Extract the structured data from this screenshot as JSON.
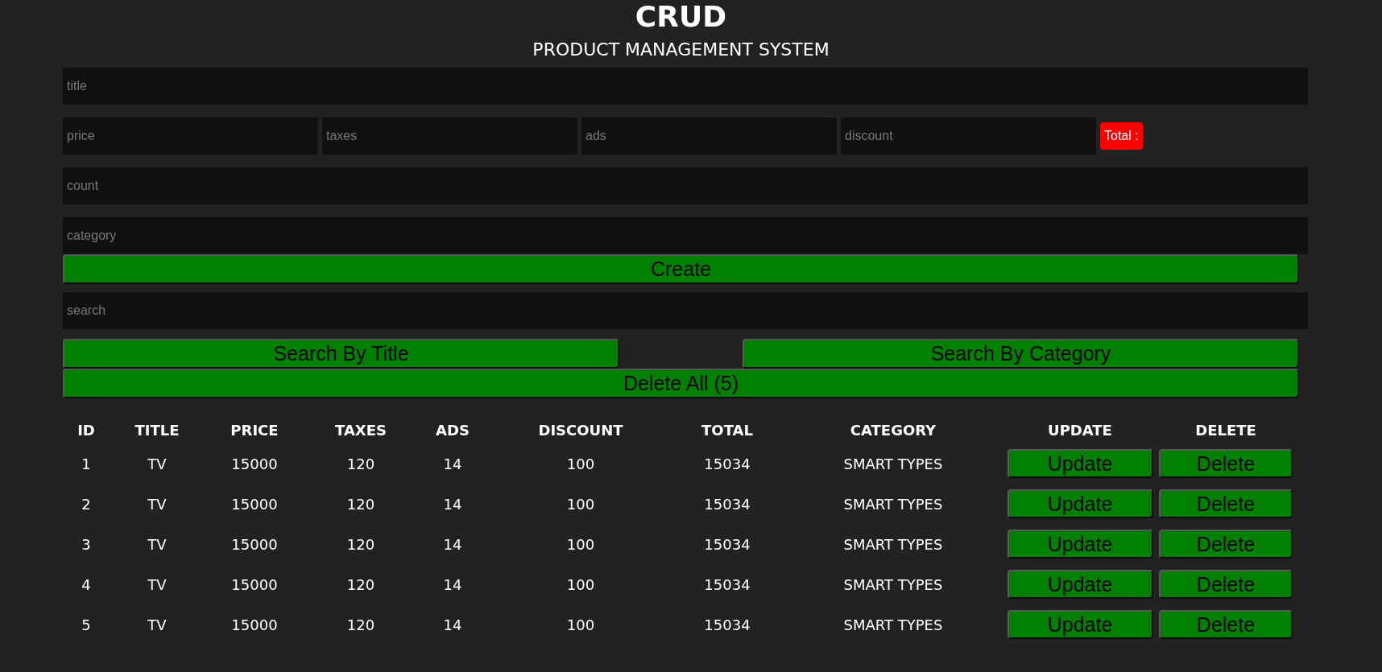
{
  "header": {
    "title": "CRUD",
    "subtitle": "PRODUCT MANAGEMENT SYSTEM"
  },
  "form": {
    "title_field": {
      "placeholder": "title"
    },
    "cost_fields": [
      {
        "placeholder": "price"
      },
      {
        "placeholder": "taxes"
      },
      {
        "placeholder": "ads"
      },
      {
        "placeholder": "discount"
      }
    ],
    "total_label": "Total :",
    "count_field": {
      "placeholder": "count"
    },
    "category_field": {
      "placeholder": "category"
    },
    "create_button": "Create"
  },
  "search": {
    "field": {
      "placeholder": "search"
    },
    "buttons": [
      "Search By Title",
      "Search By Category"
    ],
    "delete_all_button": "Delete All (5)"
  },
  "table": {
    "columns": [
      "ID",
      "TITLE",
      "PRICE",
      "TAXES",
      "ADS",
      "DISCOUNT",
      "TOTAL",
      "CATEGORY",
      "UPDATE",
      "DELETE"
    ],
    "rows": [
      {
        "cells": [
          "1",
          "TV",
          "15000",
          "120",
          "14",
          "100",
          "15034",
          "SMART TYPES"
        ],
        "update_button": "Update",
        "delete_button": "Delete"
      },
      {
        "cells": [
          "2",
          "TV",
          "15000",
          "120",
          "14",
          "100",
          "15034",
          "SMART TYPES"
        ],
        "update_button": "Update",
        "delete_button": "Delete"
      },
      {
        "cells": [
          "3",
          "TV",
          "15000",
          "120",
          "14",
          "100",
          "15034",
          "SMART TYPES"
        ],
        "update_button": "Update",
        "delete_button": "Delete"
      },
      {
        "cells": [
          "4",
          "TV",
          "15000",
          "120",
          "14",
          "100",
          "15034",
          "SMART TYPES"
        ],
        "update_button": "Update",
        "delete_button": "Delete"
      },
      {
        "cells": [
          "5",
          "TV",
          "15000",
          "120",
          "14",
          "100",
          "15034",
          "SMART TYPES"
        ],
        "update_button": "Update",
        "delete_button": "Delete"
      }
    ]
  }
}
